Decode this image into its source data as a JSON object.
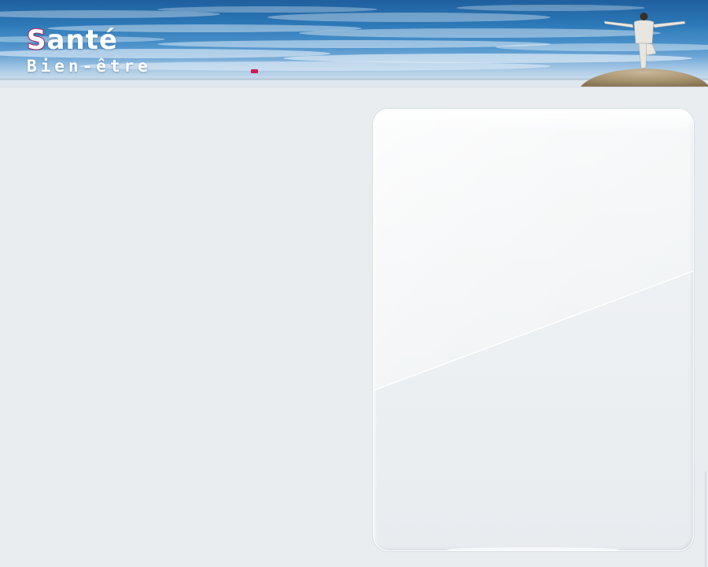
{
  "header": {
    "logo_initial": "S",
    "logo_rest": "anté",
    "tagline": "Bien-être"
  },
  "colors": {
    "brand_accent": "#c8245a",
    "background": "#e9edf0",
    "sky_top": "#1f5f9e",
    "sky_bottom": "#c7dbee"
  }
}
